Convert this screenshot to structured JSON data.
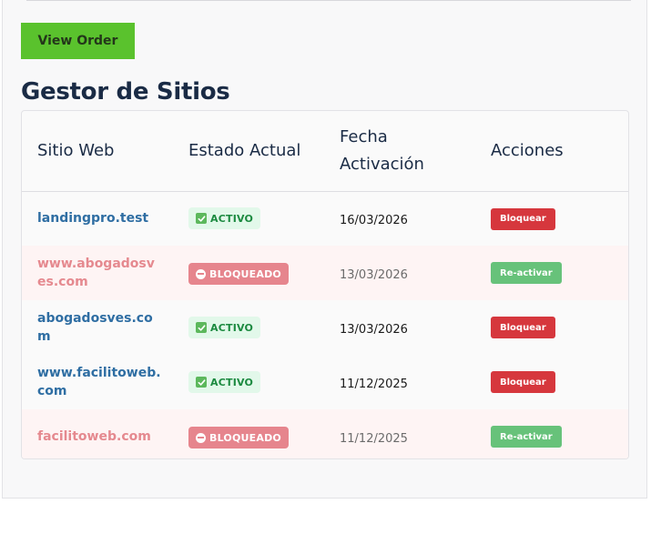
{
  "toolbar": {
    "view_order_label": "View Order"
  },
  "page": {
    "title": "Gestor de Sitios"
  },
  "table": {
    "headers": {
      "site": "Sitio Web",
      "status": "Estado Actual",
      "date": "Fecha Activación",
      "actions": "Acciones"
    },
    "rows": [
      {
        "site": "landingpro.test",
        "status": "ACTIVO",
        "status_type": "active",
        "date": "16/03/2026",
        "action": "Bloquear",
        "action_type": "block"
      },
      {
        "site": "www.abogadosves.com",
        "status": "BLOQUEADO",
        "status_type": "blocked",
        "date": "13/03/2026",
        "action": "Re-activar",
        "action_type": "reactivate"
      },
      {
        "site": "abogadosves.com",
        "status": "ACTIVO",
        "status_type": "active",
        "date": "13/03/2026",
        "action": "Bloquear",
        "action_type": "block"
      },
      {
        "site": "www.facilitoweb.com",
        "status": "ACTIVO",
        "status_type": "active",
        "date": "11/12/2025",
        "action": "Bloquear",
        "action_type": "block"
      },
      {
        "site": "facilitoweb.com",
        "status": "BLOQUEADO",
        "status_type": "blocked",
        "date": "11/12/2025",
        "action": "Re-activar",
        "action_type": "reactivate"
      }
    ]
  },
  "icons": {
    "active": "check-icon",
    "blocked": "no-entry-icon"
  },
  "colors": {
    "view_order_bg": "#5ac22d",
    "title": "#1a2b45",
    "link_active": "#2f6ea3",
    "link_blocked": "#e5898f",
    "badge_active_bg": "#e2f8ea",
    "badge_active_text": "#1c8a40",
    "badge_blocked_bg": "#e6858d",
    "block_button": "#d6373d",
    "reactivate_button": "#67c27a"
  }
}
